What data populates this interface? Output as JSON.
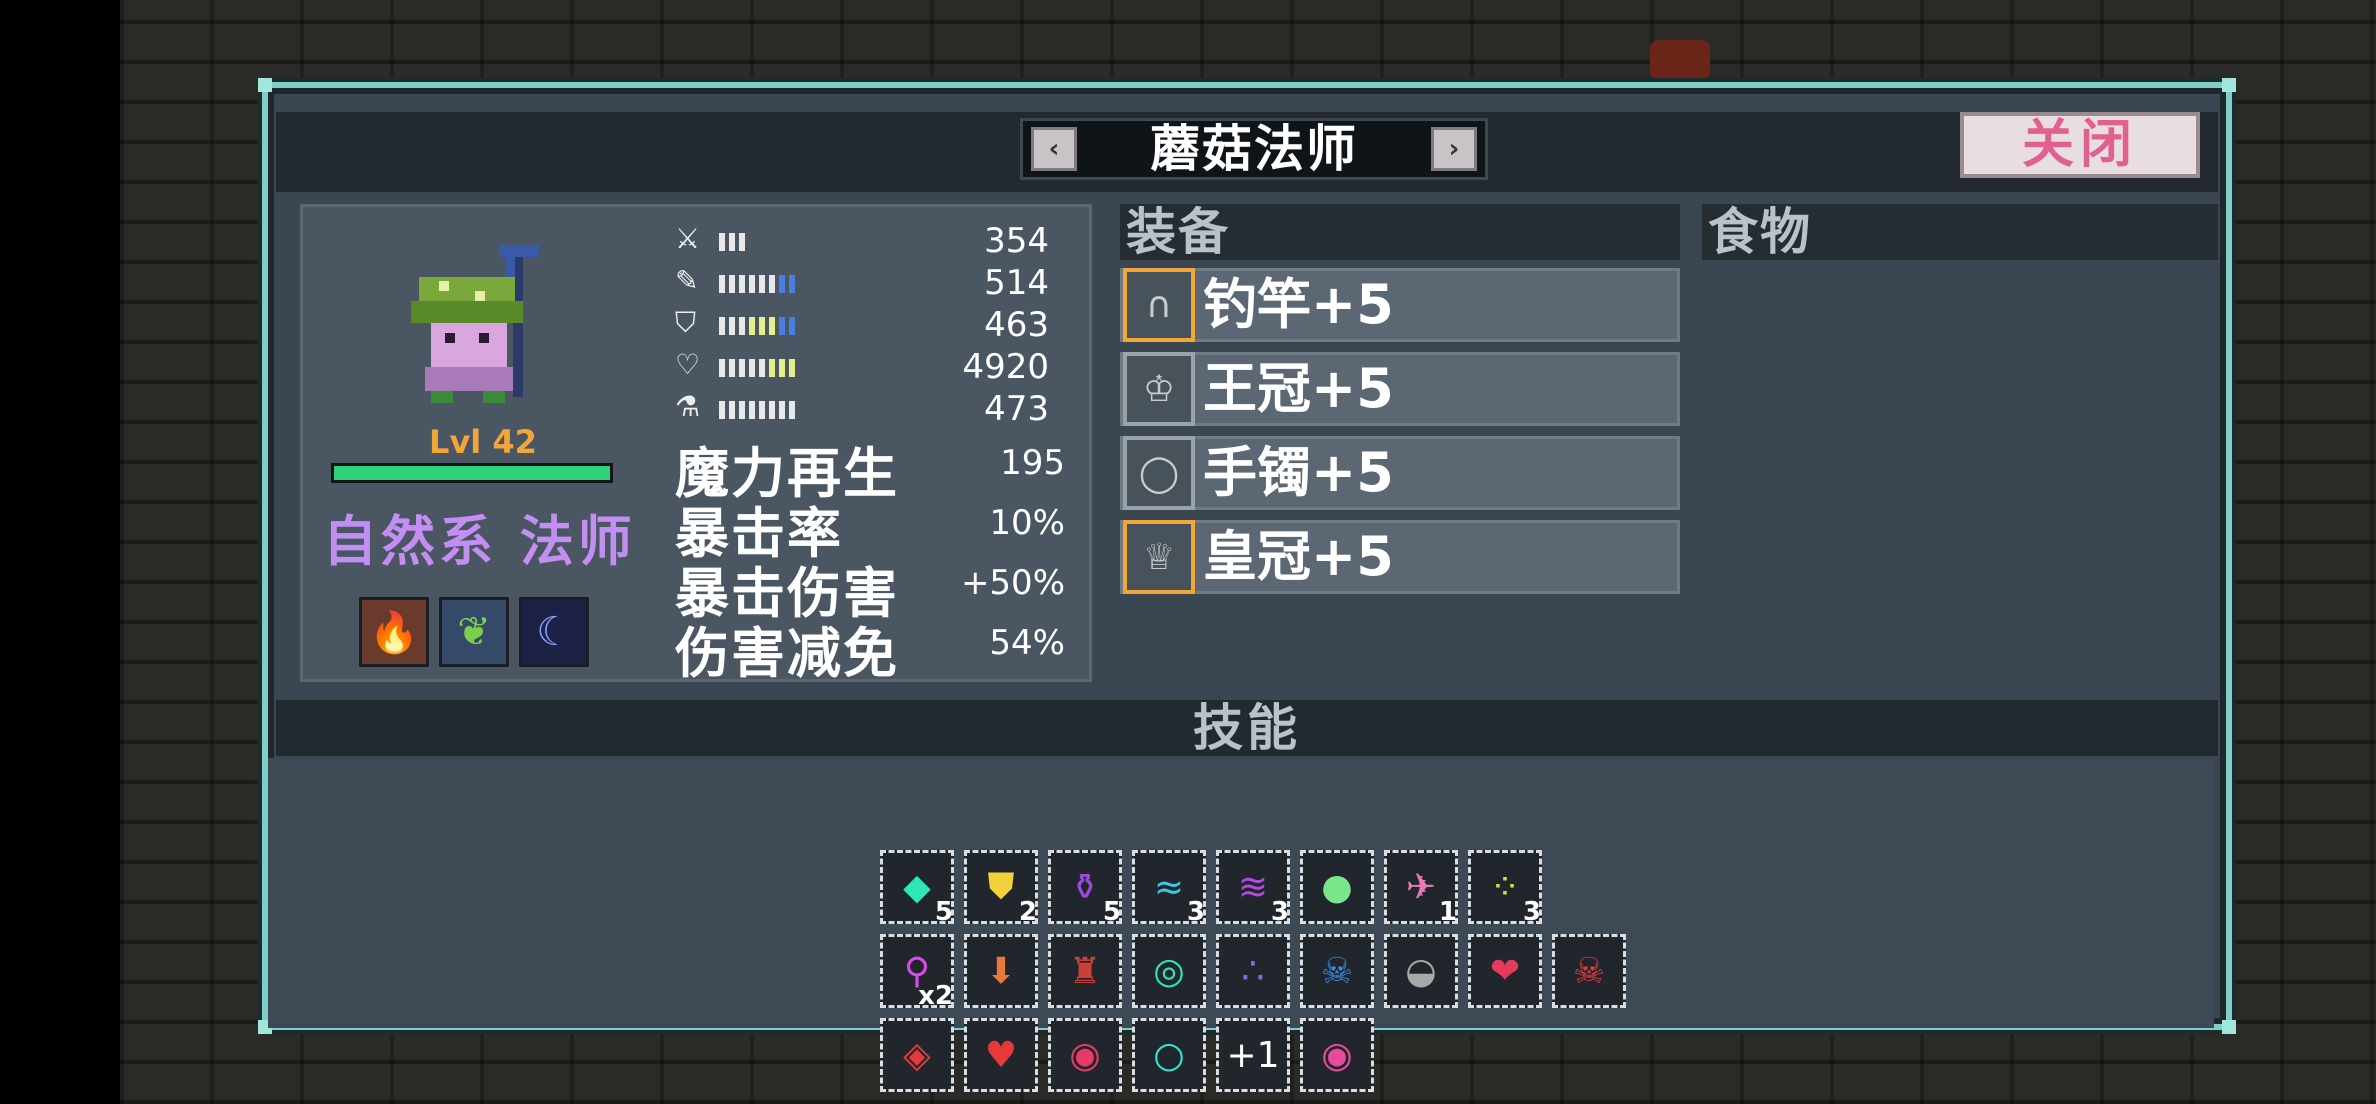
{
  "window": {
    "title": "蘑菇法师",
    "close_label": "关闭"
  },
  "character": {
    "level": "Lvl 42",
    "hp_fraction": 1.0,
    "class_label": "自然系 法师",
    "elements": [
      "fire-up-icon",
      "leaf-shield-icon",
      "moon-icon"
    ],
    "elements_label": "element"
  },
  "stats": [
    {
      "icon": "sword-icon",
      "glyph": "⚔",
      "value": "354",
      "bars": "www"
    },
    {
      "icon": "wand-icon",
      "glyph": "✎",
      "value": "514",
      "bars": "wwwwwwbb"
    },
    {
      "icon": "shield-icon",
      "glyph": "⛉",
      "value": "463",
      "bars": "wwwyyybb"
    },
    {
      "icon": "heart-icon",
      "glyph": "♡",
      "value": "4920",
      "bars": "wwwwwyyy"
    },
    {
      "icon": "flask-icon",
      "glyph": "⚗",
      "value": "473",
      "bars": "wwwwwwww"
    }
  ],
  "extra_stats": [
    {
      "label": "魔力再生",
      "value": "195"
    },
    {
      "label": "暴击率",
      "value": "10%"
    },
    {
      "label": "暴击伤害",
      "value": "+50%"
    },
    {
      "label": "伤害减免",
      "value": "54%"
    }
  ],
  "equipment_header": "装备",
  "food_header": "食物",
  "equipment": [
    {
      "icon": "fishing-rod-icon",
      "glyph": "∩",
      "label": "钓竿+5",
      "highlight": true
    },
    {
      "icon": "crown-icon",
      "glyph": "♔",
      "label": "王冠+5",
      "highlight": false
    },
    {
      "icon": "bracelet-icon",
      "glyph": "◯",
      "label": "手镯+5",
      "highlight": false
    },
    {
      "icon": "imperial-crown-icon",
      "glyph": "♕",
      "label": "皇冠+5",
      "highlight": true
    }
  ],
  "skills_header": "技能",
  "skills": {
    "row1": [
      {
        "icon": "gem-icon",
        "glyph": "◆",
        "color": "#2ee6b8",
        "count": "5"
      },
      {
        "icon": "shield-gold-icon",
        "glyph": "⛊",
        "color": "#f2d23a",
        "count": "2"
      },
      {
        "icon": "potion-icon",
        "glyph": "⚱",
        "color": "#9a4ae0",
        "count": "5"
      },
      {
        "icon": "wave-icon",
        "glyph": "≈",
        "color": "#3ac8e6",
        "count": "3"
      },
      {
        "icon": "slash-icon",
        "glyph": "≋",
        "color": "#b44ae6",
        "count": "3"
      },
      {
        "icon": "rainbow-orb-icon",
        "glyph": "●",
        "color": "#7ae68a",
        "count": ""
      },
      {
        "icon": "bird-icon",
        "glyph": "✈",
        "color": "#e67ab8",
        "count": "1"
      },
      {
        "icon": "dots-icon",
        "glyph": "⁘",
        "color": "#c8e63a",
        "count": "3"
      }
    ],
    "row2": [
      {
        "icon": "magnify-icon",
        "glyph": "⚲",
        "color": "#d84ae6",
        "count": "x2"
      },
      {
        "icon": "arrow-down-icon",
        "glyph": "⬇",
        "color": "#e67a3a",
        "count": ""
      },
      {
        "icon": "castle-icon",
        "glyph": "♜",
        "color": "#c8403a",
        "count": ""
      },
      {
        "icon": "ring-icon",
        "glyph": "◎",
        "color": "#2ee6b8",
        "count": ""
      },
      {
        "icon": "bubbles-icon",
        "glyph": "∴",
        "color": "#8a6ae6",
        "count": ""
      },
      {
        "icon": "skull-icon",
        "glyph": "☠",
        "color": "#3a8ae6",
        "count": ""
      },
      {
        "icon": "bowl-icon",
        "glyph": "◒",
        "color": "#a8a8a8",
        "count": ""
      },
      {
        "icon": "heart-drop-icon",
        "glyph": "❤",
        "color": "#e63a5a",
        "count": ""
      },
      {
        "icon": "red-skull-icon",
        "glyph": "☠",
        "color": "#e63a3a",
        "count": ""
      }
    ],
    "row3": [
      {
        "icon": "diamond-eye-icon",
        "glyph": "◈",
        "color": "#e63a3a",
        "count": ""
      },
      {
        "icon": "strawberry-icon",
        "glyph": "♥",
        "color": "#e63a3a",
        "count": ""
      },
      {
        "icon": "locked-eye-icon",
        "glyph": "◉",
        "color": "#e63a6a",
        "count": ""
      },
      {
        "icon": "orb-plus-icon",
        "glyph": "○",
        "color": "#2ee6d0",
        "count": ""
      },
      {
        "icon": "plus-one-icon",
        "glyph": "+1",
        "color": "#ffffff",
        "count": ""
      },
      {
        "icon": "pink-eye-icon",
        "glyph": "◉",
        "color": "#e64a9a",
        "count": ""
      }
    ]
  }
}
